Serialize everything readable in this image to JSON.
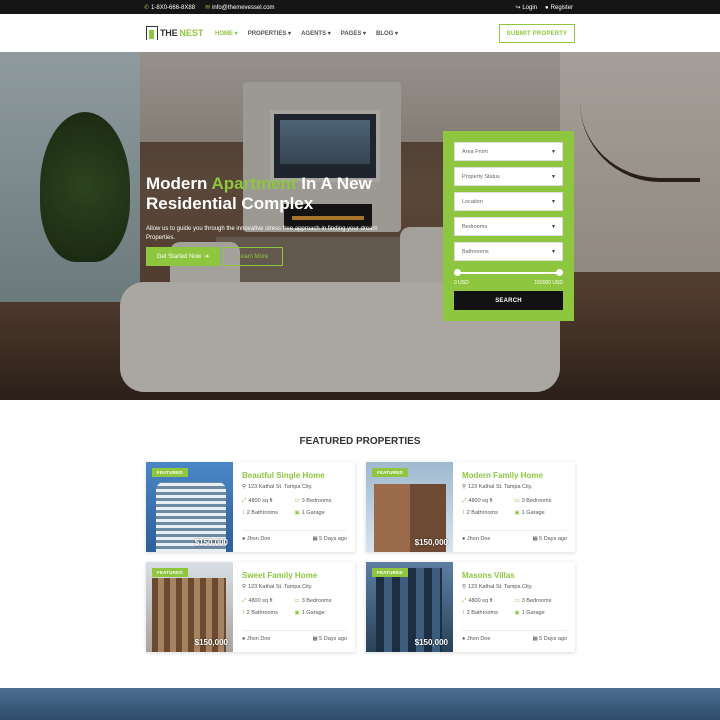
{
  "topbar": {
    "phone": "1-8X0-666-8X88",
    "email": "info@themevessel.com",
    "login": "Login",
    "register": "Register"
  },
  "header": {
    "logo_part1": "THE",
    "logo_part2": "NEST",
    "nav": [
      {
        "label": "HOME"
      },
      {
        "label": "PROPERTIES"
      },
      {
        "label": "AGENTS"
      },
      {
        "label": "PAGES"
      },
      {
        "label": "BLOG"
      }
    ],
    "submit_label": "SUBMIT PROPERTY"
  },
  "hero": {
    "title_pre": "Modern ",
    "title_hl": "Apartment",
    "title_post": " In A New Residential Complex",
    "subtitle": "Allow us to guide you through the innovative stress free approach in finding your dream Properties.",
    "btn_primary": "Get Started Now",
    "btn_secondary": "Learn More"
  },
  "search": {
    "fields": [
      {
        "label": "Area From"
      },
      {
        "label": "Property Status"
      },
      {
        "label": "Location"
      },
      {
        "label": "Bedrooms"
      },
      {
        "label": "Bathrooms"
      }
    ],
    "range_min": "0 USD",
    "range_max": "150000 USD",
    "button": "SEARCH"
  },
  "featured": {
    "title": "FEATURED PROPERTIES",
    "badge": "FEATURED",
    "cards": [
      {
        "name": "Beautful Single Home",
        "address": "123 Kathal St. Tampa City.",
        "area": "4800 sq ft",
        "bedrooms": "3 Bedrooms",
        "bathrooms": "2 Bathrooms",
        "garage": "1 Garage",
        "agent": "Jhon Doe",
        "date": "5 Days ago",
        "price": "$150,000"
      },
      {
        "name": "Modern Family Home",
        "address": "123 Kathal St. Tampa City.",
        "area": "4800 sq ft",
        "bedrooms": "3 Bedrooms",
        "bathrooms": "2 Bathrooms",
        "garage": "1 Garage",
        "agent": "Jhon Doe",
        "date": "5 Days ago",
        "price": "$150,000"
      },
      {
        "name": "Sweet Family Home",
        "address": "123 Kathal St. Tampa City.",
        "area": "4800 sq ft",
        "bedrooms": "3 Bedrooms",
        "bathrooms": "2 Bathrooms",
        "garage": "1 Garage",
        "agent": "Jhon Doe",
        "date": "5 Days ago",
        "price": "$150,000"
      },
      {
        "name": "Masons Villas",
        "address": "123 Kathal St. Tampa City.",
        "area": "4800 sq ft",
        "bedrooms": "3 Bedrooms",
        "bathrooms": "2 Bathrooms",
        "garage": "1 Garage",
        "agent": "Jhon Doe",
        "date": "5 Days ago",
        "price": "$150,000"
      }
    ]
  },
  "colors": {
    "accent": "#8ec63f",
    "dark": "#151515"
  }
}
